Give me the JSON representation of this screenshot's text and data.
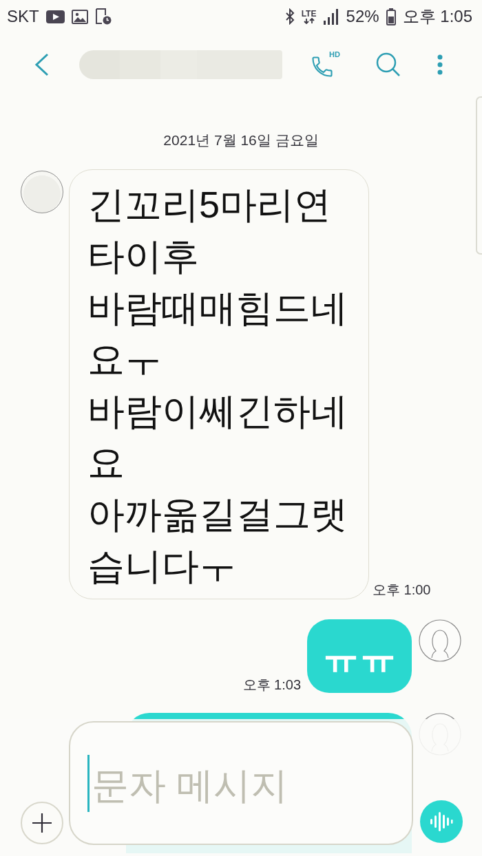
{
  "status_bar": {
    "carrier": "SKT",
    "network": "LTE",
    "battery": "52%",
    "time": "오후 1:05"
  },
  "app_bar": {
    "call_badge": "HD"
  },
  "date_divider": "2021년 7월 16일 금요일",
  "messages": [
    {
      "kind": "received",
      "lines": [
        "긴꼬리5마리연타이후",
        "바람때매힘드네요ㅜ",
        "바람이쎄긴하네요",
        "아까옮길걸그랫습니다ㅜ"
      ],
      "time": "오후 1:00"
    },
    {
      "kind": "sent",
      "lines": [
        "ㅠㅠ"
      ],
      "time": "오후 1:03"
    },
    {
      "kind": "sent",
      "covered": true
    }
  ],
  "composer": {
    "placeholder": "문자 메시지"
  }
}
